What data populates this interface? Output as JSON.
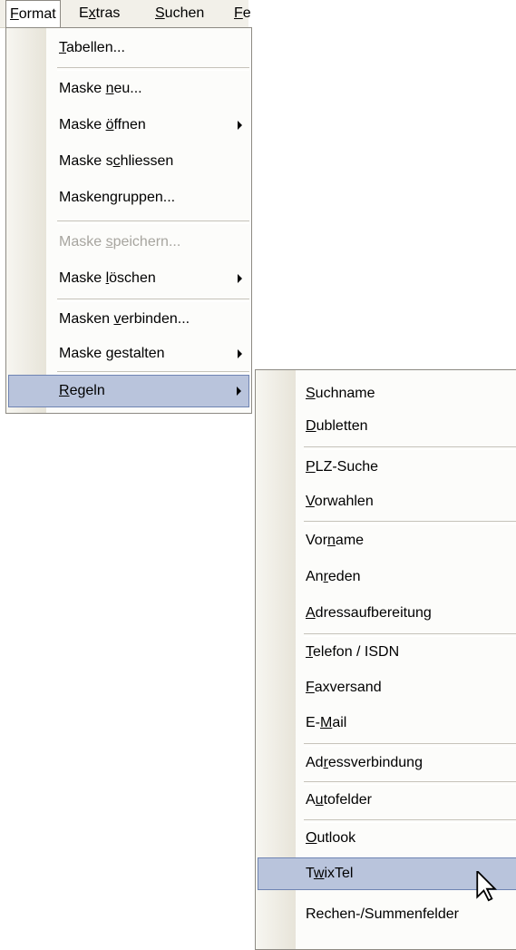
{
  "menubar": {
    "items": [
      {
        "pre": "",
        "u": "F",
        "post": "ormat"
      },
      {
        "pre": "E",
        "u": "x",
        "post": "tras"
      },
      {
        "pre": "",
        "u": "S",
        "post": "uchen"
      },
      {
        "pre": "",
        "u": "F",
        "post": "e"
      }
    ]
  },
  "format_menu": {
    "items": [
      {
        "pre": "",
        "u": "T",
        "post": "abellen..."
      },
      {
        "pre": "Maske ",
        "u": "n",
        "post": "eu..."
      },
      {
        "pre": "Maske ",
        "u": "ö",
        "post": "ffnen"
      },
      {
        "pre": "Maske s",
        "u": "c",
        "post": "hliessen"
      },
      {
        "pre": "Maskengruppen...",
        "u": "",
        "post": ""
      },
      {
        "pre": "Maske ",
        "u": "s",
        "post": "peichern..."
      },
      {
        "pre": "Maske ",
        "u": "l",
        "post": "öschen"
      },
      {
        "pre": "Masken ",
        "u": "v",
        "post": "erbinden..."
      },
      {
        "pre": "Maske ",
        "u": "g",
        "post": "estalten"
      },
      {
        "pre": "",
        "u": "R",
        "post": "egeln"
      }
    ]
  },
  "regeln_submenu": {
    "items": [
      {
        "pre": "",
        "u": "S",
        "post": "uchname"
      },
      {
        "pre": "",
        "u": "D",
        "post": "ubletten"
      },
      {
        "pre": "",
        "u": "P",
        "post": "LZ-Suche"
      },
      {
        "pre": "",
        "u": "V",
        "post": "orwahlen"
      },
      {
        "pre": "Vor",
        "u": "n",
        "post": "ame"
      },
      {
        "pre": "An",
        "u": "r",
        "post": "eden"
      },
      {
        "pre": "",
        "u": "A",
        "post": "dressaufbereitung"
      },
      {
        "pre": "",
        "u": "T",
        "post": "elefon / ISDN"
      },
      {
        "pre": "",
        "u": "F",
        "post": "axversand"
      },
      {
        "pre": "E-",
        "u": "M",
        "post": "ail"
      },
      {
        "pre": "Ad",
        "u": "r",
        "post": "essverbindung"
      },
      {
        "pre": "A",
        "u": "u",
        "post": "tofelder"
      },
      {
        "pre": "",
        "u": "O",
        "post": "utlook"
      },
      {
        "pre": "T",
        "u": "w",
        "post": "ixTel"
      },
      {
        "pre": "Rechen-/Summenfelder",
        "u": "",
        "post": ""
      }
    ]
  }
}
